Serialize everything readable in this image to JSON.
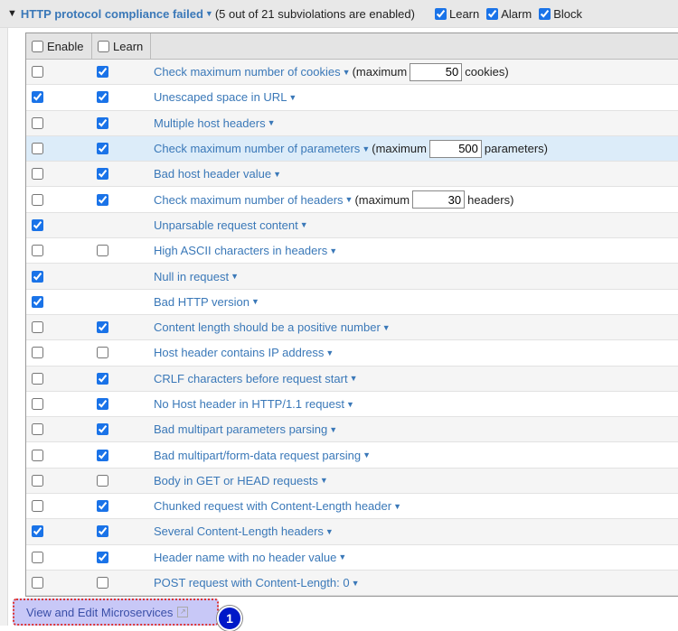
{
  "header": {
    "title": "HTTP protocol compliance failed",
    "summary": "(5 out of 21 subviolations are enabled)",
    "learn": "Learn",
    "alarm": "Alarm",
    "block": "Block",
    "learn_checked": true,
    "alarm_checked": true,
    "block_checked": true
  },
  "table": {
    "col_enable": "Enable",
    "col_learn": "Learn",
    "rows": [
      {
        "label": "Check maximum number of cookies",
        "enable": false,
        "learn": true,
        "pre": "(maximum",
        "value": "50",
        "post": "cookies)"
      },
      {
        "label": "Unescaped space in URL",
        "enable": true,
        "learn": true
      },
      {
        "label": "Multiple host headers",
        "enable": false,
        "learn": true
      },
      {
        "label": "Check maximum number of parameters",
        "enable": false,
        "learn": true,
        "pre": "(maximum",
        "value": "500",
        "post": "parameters)",
        "highlight": true
      },
      {
        "label": "Bad host header value",
        "enable": false,
        "learn": true
      },
      {
        "label": "Check maximum number of headers",
        "enable": false,
        "learn": true,
        "pre": "(maximum",
        "value": "30",
        "post": "headers)"
      },
      {
        "label": "Unparsable request content",
        "enable": true,
        "learn": null
      },
      {
        "label": "High ASCII characters in headers",
        "enable": false,
        "learn": false
      },
      {
        "label": "Null in request",
        "enable": true,
        "learn": null
      },
      {
        "label": "Bad HTTP version",
        "enable": true,
        "learn": null
      },
      {
        "label": "Content length should be a positive number",
        "enable": false,
        "learn": true
      },
      {
        "label": "Host header contains IP address",
        "enable": false,
        "learn": false
      },
      {
        "label": "CRLF characters before request start",
        "enable": false,
        "learn": true
      },
      {
        "label": "No Host header in HTTP/1.1 request",
        "enable": false,
        "learn": true
      },
      {
        "label": "Bad multipart parameters parsing",
        "enable": false,
        "learn": true
      },
      {
        "label": "Bad multipart/form-data request parsing",
        "enable": false,
        "learn": true
      },
      {
        "label": "Body in GET or HEAD requests",
        "enable": false,
        "learn": false
      },
      {
        "label": "Chunked request with Content-Length header",
        "enable": false,
        "learn": true
      },
      {
        "label": "Several Content-Length headers",
        "enable": true,
        "learn": true
      },
      {
        "label": "Header name with no header value",
        "enable": false,
        "learn": true
      },
      {
        "label": "POST request with Content-Length: 0",
        "enable": false,
        "learn": false
      }
    ]
  },
  "microservices": {
    "label": "View and Edit Microservices",
    "icon": "external-link-icon"
  },
  "badge": "1"
}
